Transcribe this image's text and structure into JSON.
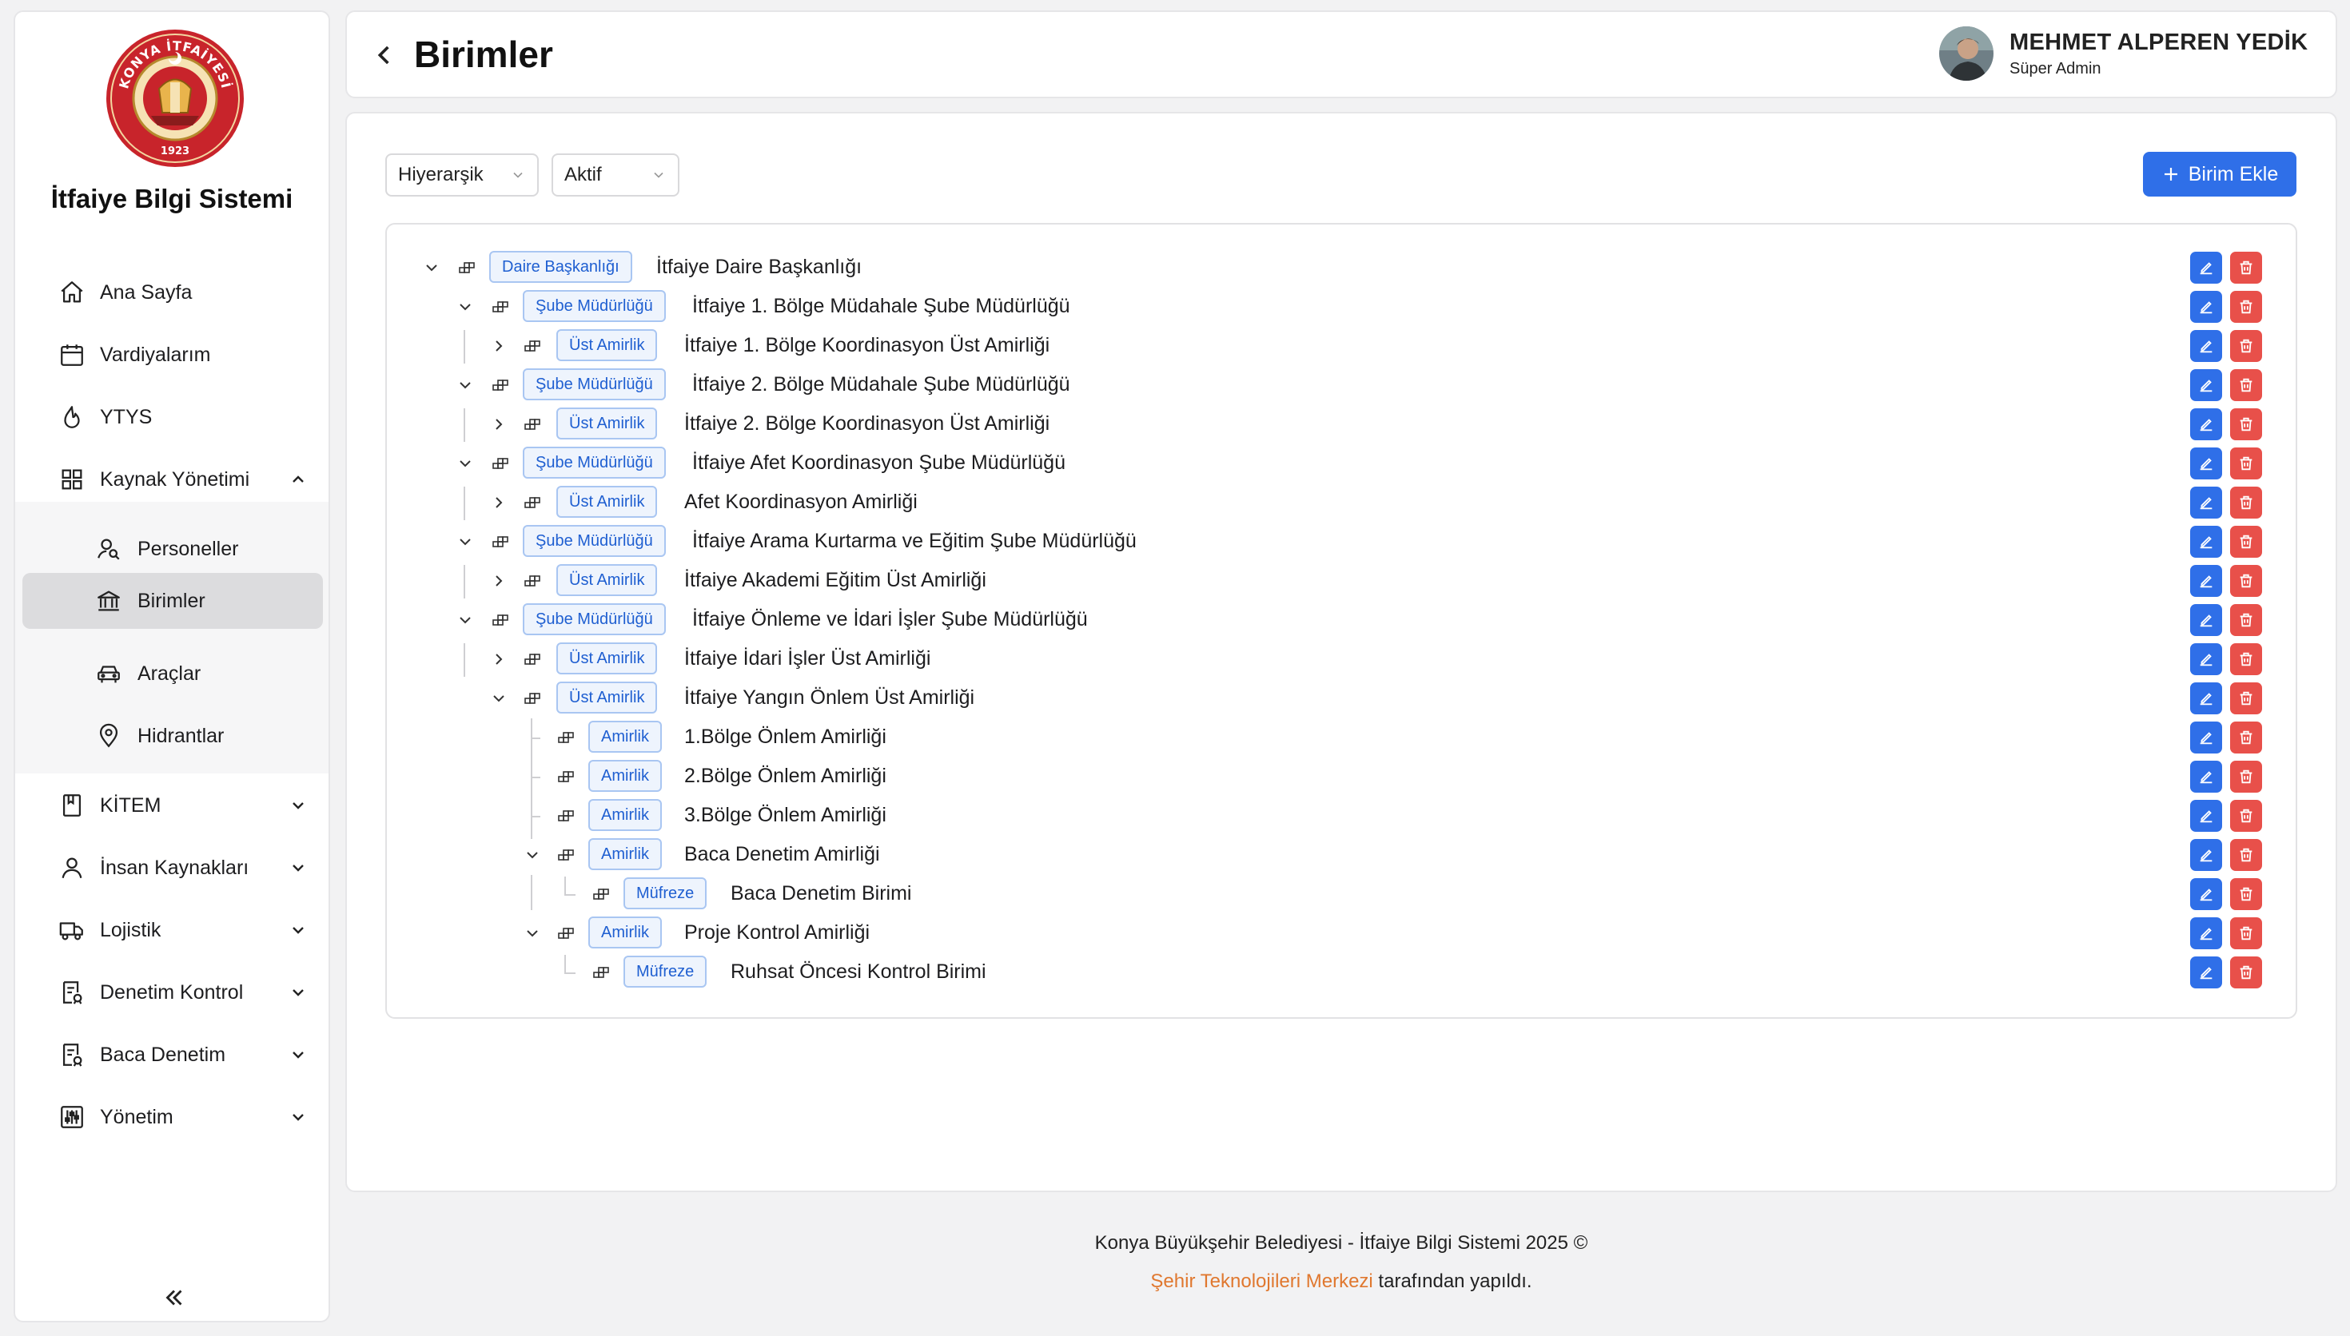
{
  "app": {
    "title": "İtfaiye Bilgi Sistemi",
    "logo_text_top": "KONYA İTFAİYESİ",
    "logo_year": "1923"
  },
  "sidebar": {
    "items": [
      {
        "label": "Ana Sayfa",
        "icon": "home-icon"
      },
      {
        "label": "Vardiyalarım",
        "icon": "calendar-icon"
      },
      {
        "label": "YTYS",
        "icon": "flame-icon"
      },
      {
        "label": "Kaynak Yönetimi",
        "icon": "grid-icon",
        "expanded": true
      },
      {
        "label": "Personeller",
        "icon": "users-search-icon"
      },
      {
        "label": "Birimler",
        "icon": "building-icon",
        "active": true
      },
      {
        "label": "Araçlar",
        "icon": "car-icon"
      },
      {
        "label": "Hidrantlar",
        "icon": "map-pin-icon"
      },
      {
        "label": "KİTEM",
        "icon": "book-icon"
      },
      {
        "label": "İnsan Kaynakları",
        "icon": "user-icon"
      },
      {
        "label": "Lojistik",
        "icon": "truck-icon"
      },
      {
        "label": "Denetim Kontrol",
        "icon": "report-icon"
      },
      {
        "label": "Baca Denetim",
        "icon": "report-icon"
      },
      {
        "label": "Yönetim",
        "icon": "sliders-icon"
      }
    ]
  },
  "header": {
    "title": "Birimler",
    "user_name": "MEHMET ALPEREN YEDİK",
    "user_role": "Süper Admin"
  },
  "filters": {
    "view": "Hiyerarşik",
    "status": "Aktif"
  },
  "actions": {
    "add_label": "Birim Ekle"
  },
  "tree": [
    {
      "level": 0,
      "toggle": "expanded",
      "type": "Daire Başkanlığı",
      "name": "İtfaiye Daire Başkanlığı"
    },
    {
      "level": 1,
      "toggle": "expanded",
      "type": "Şube Müdürlüğü",
      "name": "İtfaiye 1. Bölge Müdahale Şube Müdürlüğü"
    },
    {
      "level": 2,
      "toggle": "collapsed",
      "type": "Üst Amirlik",
      "name": "İtfaiye 1. Bölge Koordinasyon Üst Amirliği"
    },
    {
      "level": 1,
      "toggle": "expanded",
      "type": "Şube Müdürlüğü",
      "name": "İtfaiye 2. Bölge Müdahale Şube Müdürlüğü"
    },
    {
      "level": 2,
      "toggle": "collapsed",
      "type": "Üst Amirlik",
      "name": "İtfaiye 2. Bölge Koordinasyon Üst Amirliği"
    },
    {
      "level": 1,
      "toggle": "expanded",
      "type": "Şube Müdürlüğü",
      "name": "İtfaiye Afet Koordinasyon Şube Müdürlüğü"
    },
    {
      "level": 2,
      "toggle": "collapsed",
      "type": "Üst Amirlik",
      "name": "Afet Koordinasyon Amirliği"
    },
    {
      "level": 1,
      "toggle": "expanded",
      "type": "Şube Müdürlüğü",
      "name": "İtfaiye Arama Kurtarma ve Eğitim Şube Müdürlüğü"
    },
    {
      "level": 2,
      "toggle": "collapsed",
      "type": "Üst Amirlik",
      "name": "İtfaiye Akademi Eğitim Üst Amirliği"
    },
    {
      "level": 1,
      "toggle": "expanded",
      "type": "Şube Müdürlüğü",
      "name": "İtfaiye Önleme ve İdari İşler Şube Müdürlüğü"
    },
    {
      "level": 2,
      "toggle": "collapsed",
      "type": "Üst Amirlik",
      "name": "İtfaiye İdari İşler Üst Amirliği"
    },
    {
      "level": 2,
      "toggle": "expanded",
      "type": "Üst Amirlik",
      "name": "İtfaiye Yangın Önlem Üst Amirliği"
    },
    {
      "level": 3,
      "toggle": "leaf",
      "type": "Amirlik",
      "name": "1.Bölge Önlem Amirliği"
    },
    {
      "level": 3,
      "toggle": "leaf",
      "type": "Amirlik",
      "name": "2.Bölge Önlem Amirliği"
    },
    {
      "level": 3,
      "toggle": "leaf",
      "type": "Amirlik",
      "name": "3.Bölge Önlem Amirliği"
    },
    {
      "level": 3,
      "toggle": "expanded",
      "type": "Amirlik",
      "name": "Baca Denetim Amirliği"
    },
    {
      "level": 4,
      "toggle": "leaf",
      "type": "Müfreze",
      "name": "Baca Denetim Birimi"
    },
    {
      "level": 3,
      "toggle": "expanded",
      "type": "Amirlik",
      "name": "Proje Kontrol Amirliği"
    },
    {
      "level": 4,
      "toggle": "leaf",
      "type": "Müfreze",
      "name": "Ruhsat Öncesi Kontrol Birimi"
    }
  ],
  "footer": {
    "line1": "Konya Büyükşehir Belediyesi - İtfaiye Bilgi Sistemi 2025 ©",
    "link": "Şehir Teknolojileri Merkezi",
    "line2_suffix": " tarafından yapıldı."
  },
  "colors": {
    "primary": "#2f6fe8",
    "danger": "#e8504a",
    "badge_bg": "#eef4fd",
    "badge_border": "#a9c6f2",
    "link": "#e0782f",
    "logo_red": "#c8242b"
  }
}
